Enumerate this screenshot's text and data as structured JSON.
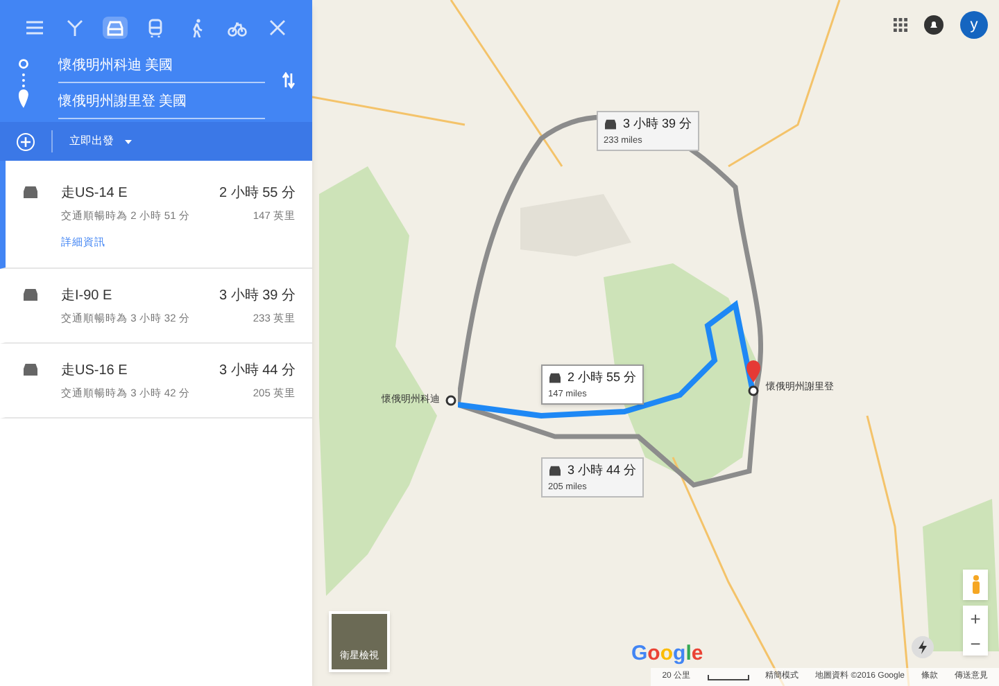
{
  "header": {
    "modes": [
      {
        "kind": "menu",
        "selected": false
      },
      {
        "kind": "best",
        "selected": false
      },
      {
        "kind": "car",
        "selected": true
      },
      {
        "kind": "transit",
        "selected": false
      },
      {
        "kind": "walk",
        "selected": false
      },
      {
        "kind": "bike",
        "selected": false
      },
      {
        "kind": "close",
        "selected": false
      }
    ],
    "origin": "懷俄明州科迪 美國",
    "destination": "懷俄明州謝里登 美國"
  },
  "depart": {
    "label": "立即出發"
  },
  "routes": [
    {
      "via": "走US-14 E",
      "time": "2 小時 55 分",
      "traffic": "交通順暢時為 2 小時 51 分",
      "distance": "147 英里",
      "details": "詳細資訊",
      "selected": true
    },
    {
      "via": "走I-90 E",
      "time": "3 小時 39 分",
      "traffic": "交通順暢時為 3 小時 32 分",
      "distance": "233 英里",
      "selected": false
    },
    {
      "via": "走US-16 E",
      "time": "3 小時 44 分",
      "traffic": "交通順暢時為 3 小時 42 分",
      "distance": "205 英里",
      "selected": false
    }
  ],
  "map": {
    "origin_label": "懷俄明州科迪",
    "destination_label": "懷俄明州謝里登",
    "callouts": [
      {
        "time": "3 小時 39 分",
        "distance": "233 miles",
        "selected": false
      },
      {
        "time": "2 小時 55 分",
        "distance": "147 miles",
        "selected": true
      },
      {
        "time": "3 小時 44 分",
        "distance": "205 miles",
        "selected": false
      }
    ],
    "logo": "Google",
    "account_initial": "y",
    "satellite_label": "衛星檢視",
    "zoom_in": "+",
    "zoom_out": "−",
    "footer": {
      "scale": "20 公里",
      "lite_mode": "精簡模式",
      "attribution": "地圖資料 ©2016 Google",
      "terms": "條款",
      "feedback": "傳送意見"
    }
  }
}
